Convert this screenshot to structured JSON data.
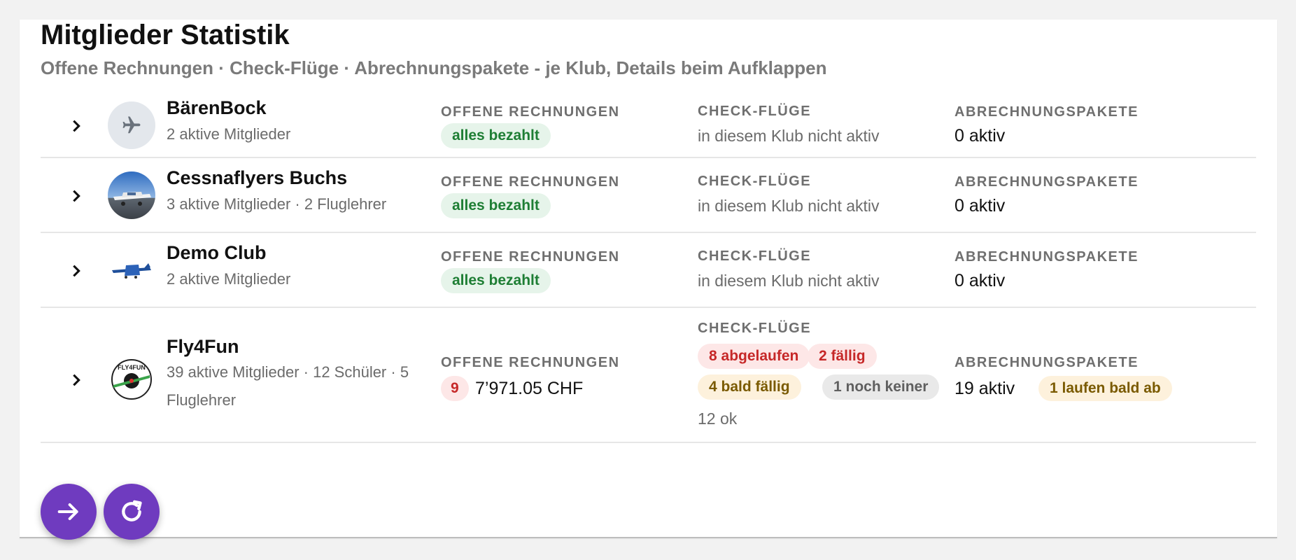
{
  "header": {
    "title": "Mitglieder Statistik",
    "subtitle": "Offene Rechnungen · Check-Flüge · Abrechnungspakete - je Klub, Details beim Aufklappen"
  },
  "columns": {
    "invoices": "OFFENE RECHNUNGEN",
    "checkflights": "CHECK-FLÜGE",
    "packages": "ABRECHNUNGSPAKETE"
  },
  "clubs": [
    {
      "name": "BärenBock",
      "meta": "2 aktive Mitglieder",
      "invoices_chip": "alles bezahlt",
      "checkflights_text": "in diesem Klub nicht aktiv",
      "packages_value": "0 aktiv",
      "avatar_icon": "airplane-icon"
    },
    {
      "name": "Cessnaflyers Buchs",
      "meta": "3 aktive Mitglieder · 2 Fluglehrer",
      "invoices_chip": "alles bezahlt",
      "checkflights_text": "in diesem Klub nicht aktiv",
      "packages_value": "0 aktiv",
      "avatar_icon": "club-photo"
    },
    {
      "name": "Demo Club",
      "meta": "2 aktive Mitglieder",
      "invoices_chip": "alles bezahlt",
      "checkflights_text": "in diesem Klub nicht aktiv",
      "packages_value": "0 aktiv",
      "avatar_icon": "club-logo"
    },
    {
      "name": "Fly4Fun",
      "meta_line1": "39 aktive Mitglieder · 12 Schüler · 5",
      "meta_line2": "Fluglehrer",
      "invoices_count": "9",
      "invoices_amount": "7’971.05 CHF",
      "checkflights_expired": "8 abgelaufen",
      "checkflights_due": "2 fällig",
      "checkflights_soon": "4 bald fällig",
      "checkflights_none": "1 noch keiner",
      "checkflights_ok": "12 ok",
      "packages_value": "19 aktiv",
      "packages_expiring": "1 laufen bald ab",
      "avatar_icon": "club-logo"
    }
  ],
  "actions": {
    "open_icon": "arrow-right-icon",
    "refresh_icon": "refresh-icon"
  },
  "colors": {
    "accent": "#6f3bbf",
    "ok": "#1e7e34",
    "error": "#c62828",
    "warning": "#7a5a00"
  }
}
